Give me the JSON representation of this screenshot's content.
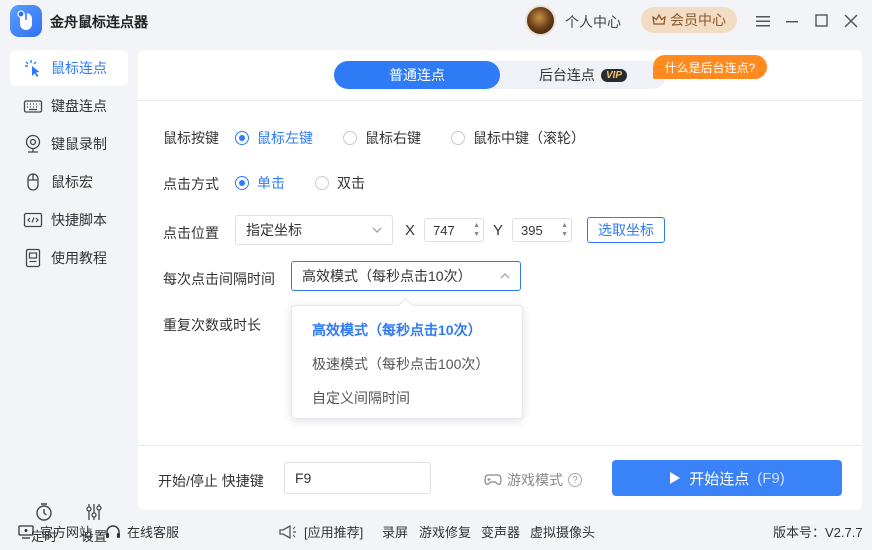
{
  "app": {
    "title": "金舟鼠标连点器",
    "profile_label": "个人中心",
    "vip_label": "会员中心"
  },
  "sidebar": {
    "items": [
      {
        "label": "鼠标连点",
        "icon": "mouse-click-icon"
      },
      {
        "label": "键盘连点",
        "icon": "keyboard-icon"
      },
      {
        "label": "键鼠录制",
        "icon": "webcam-record-icon"
      },
      {
        "label": "鼠标宏",
        "icon": "mouse-icon"
      },
      {
        "label": "快捷脚本",
        "icon": "code-icon"
      },
      {
        "label": "使用教程",
        "icon": "tutorial-icon"
      }
    ],
    "timer_label": "定时",
    "settings_label": "设置"
  },
  "tabs": {
    "normal": "普通连点",
    "background": "后台连点",
    "vip_tag": "VIP",
    "hint": "什么是后台连点?"
  },
  "form": {
    "mouse_button_label": "鼠标按键",
    "mouse_buttons": [
      "鼠标左键",
      "鼠标右键",
      "鼠标中键（滚轮）"
    ],
    "click_mode_label": "点击方式",
    "click_modes": [
      "单击",
      "双击"
    ],
    "position_label": "点击位置",
    "position_value": "指定坐标",
    "x_label": "X",
    "x_value": "747",
    "y_label": "Y",
    "y_value": "395",
    "pick_button": "选取坐标",
    "interval_label": "每次点击间隔时间",
    "interval_value": "高效模式（每秒点击10次）",
    "interval_options": [
      "高效模式（每秒点击10次）",
      "极速模式（每秒点击100次）",
      "自定义间隔时间"
    ],
    "repeat_label": "重复次数或时长"
  },
  "footer": {
    "hotkey_label": "开始/停止 快捷键",
    "hotkey_value": "F9",
    "game_mode": "游戏模式",
    "start_label": "开始连点",
    "start_hotkey": "(F9)"
  },
  "statusbar": {
    "website": "官方网站",
    "support": "在线客服",
    "recommend": "[应用推荐]",
    "links": [
      "录屏",
      "游戏修复",
      "变声器",
      "虚拟摄像头"
    ],
    "version": "版本号：V2.7.7"
  },
  "colors": {
    "accent": "#2f7bf5",
    "hint": "#ff8a1f",
    "vip_bg": "#f3dcc4"
  }
}
